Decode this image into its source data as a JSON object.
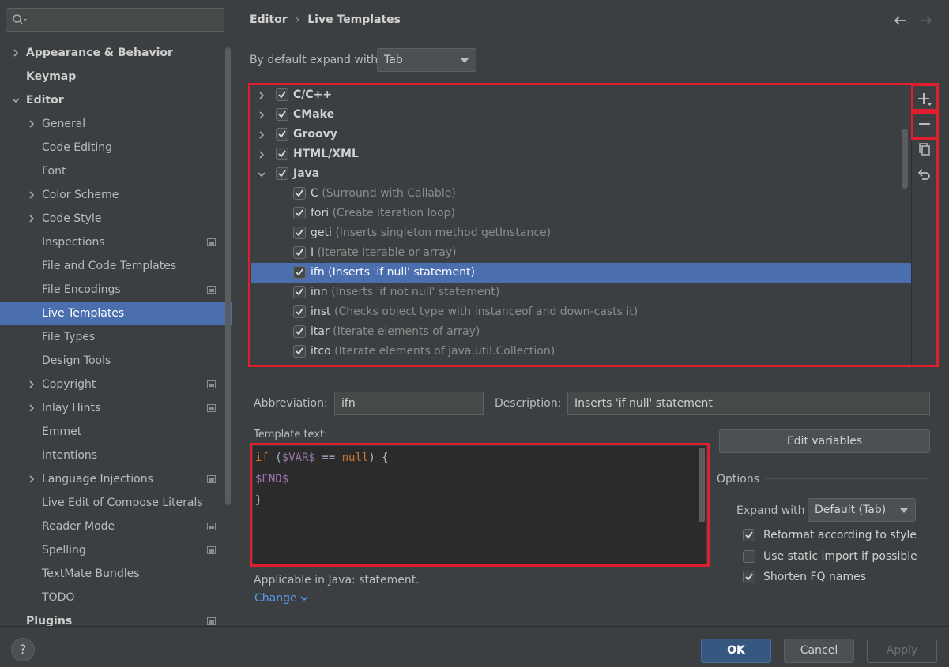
{
  "search": {
    "placeholder": ""
  },
  "sidebar": {
    "items": [
      {
        "label": "Appearance & Behavior",
        "bold": true,
        "chevron": "right",
        "indent": 0
      },
      {
        "label": "Keymap",
        "bold": true,
        "chevron": "",
        "indent": 0
      },
      {
        "label": "Editor",
        "bold": true,
        "chevron": "down",
        "indent": 0
      },
      {
        "label": "General",
        "bold": false,
        "chevron": "right",
        "indent": 1
      },
      {
        "label": "Code Editing",
        "bold": false,
        "chevron": "",
        "indent": 1
      },
      {
        "label": "Font",
        "bold": false,
        "chevron": "",
        "indent": 1
      },
      {
        "label": "Color Scheme",
        "bold": false,
        "chevron": "right",
        "indent": 1
      },
      {
        "label": "Code Style",
        "bold": false,
        "chevron": "right",
        "indent": 1
      },
      {
        "label": "Inspections",
        "bold": false,
        "chevron": "",
        "indent": 1,
        "project_icon": true
      },
      {
        "label": "File and Code Templates",
        "bold": false,
        "chevron": "",
        "indent": 1
      },
      {
        "label": "File Encodings",
        "bold": false,
        "chevron": "",
        "indent": 1,
        "project_icon": true
      },
      {
        "label": "Live Templates",
        "bold": false,
        "chevron": "",
        "indent": 1,
        "selected": true
      },
      {
        "label": "File Types",
        "bold": false,
        "chevron": "",
        "indent": 1
      },
      {
        "label": "Design Tools",
        "bold": false,
        "chevron": "",
        "indent": 1
      },
      {
        "label": "Copyright",
        "bold": false,
        "chevron": "right",
        "indent": 1,
        "project_icon": true
      },
      {
        "label": "Inlay Hints",
        "bold": false,
        "chevron": "right",
        "indent": 1,
        "project_icon": true
      },
      {
        "label": "Emmet",
        "bold": false,
        "chevron": "",
        "indent": 1
      },
      {
        "label": "Intentions",
        "bold": false,
        "chevron": "",
        "indent": 1
      },
      {
        "label": "Language Injections",
        "bold": false,
        "chevron": "right",
        "indent": 1,
        "project_icon": true
      },
      {
        "label": "Live Edit of Compose Literals",
        "bold": false,
        "chevron": "",
        "indent": 1
      },
      {
        "label": "Reader Mode",
        "bold": false,
        "chevron": "",
        "indent": 1,
        "project_icon": true
      },
      {
        "label": "Spelling",
        "bold": false,
        "chevron": "",
        "indent": 1,
        "project_icon": true
      },
      {
        "label": "TextMate Bundles",
        "bold": false,
        "chevron": "",
        "indent": 1
      },
      {
        "label": "TODO",
        "bold": false,
        "chevron": "",
        "indent": 1
      },
      {
        "label": "Plugins",
        "bold": true,
        "chevron": "",
        "indent": 0,
        "project_icon": true
      }
    ]
  },
  "breadcrumb": {
    "parent": "Editor",
    "separator": "›",
    "current": "Live Templates"
  },
  "expand": {
    "label": "By default expand with",
    "value": "Tab"
  },
  "tree": {
    "rows": [
      {
        "name": "C/C++",
        "desc": "",
        "group": true,
        "expanded": false,
        "checked": true
      },
      {
        "name": "CMake",
        "desc": "",
        "group": true,
        "expanded": false,
        "checked": true
      },
      {
        "name": "Groovy",
        "desc": "",
        "group": true,
        "expanded": false,
        "checked": true
      },
      {
        "name": "HTML/XML",
        "desc": "",
        "group": true,
        "expanded": false,
        "checked": true
      },
      {
        "name": "Java",
        "desc": "",
        "group": true,
        "expanded": true,
        "checked": true
      },
      {
        "name": "C",
        "desc": "(Surround with Callable)",
        "group": false,
        "checked": true
      },
      {
        "name": "fori",
        "desc": "(Create iteration loop)",
        "group": false,
        "checked": true
      },
      {
        "name": "geti",
        "desc": "(Inserts singleton method getInstance)",
        "group": false,
        "checked": true
      },
      {
        "name": "I",
        "desc": "(Iterate Iterable or array)",
        "group": false,
        "checked": true
      },
      {
        "name": "ifn",
        "desc": "(Inserts 'if null' statement)",
        "group": false,
        "checked": true,
        "selected": true
      },
      {
        "name": "inn",
        "desc": "(Inserts 'if not null' statement)",
        "group": false,
        "checked": true
      },
      {
        "name": "inst",
        "desc": "(Checks object type with instanceof and down-casts it)",
        "group": false,
        "checked": true
      },
      {
        "name": "itar",
        "desc": "(Iterate elements of array)",
        "group": false,
        "checked": true
      },
      {
        "name": "itco",
        "desc": "(Iterate elements of java.util.Collection)",
        "group": false,
        "checked": true
      }
    ]
  },
  "details": {
    "abbreviation_label": "Abbreviation:",
    "abbreviation_value": "ifn",
    "description_label": "Description:",
    "description_value": "Inserts 'if null' statement",
    "template_text_label": "Template text:",
    "edit_variables": "Edit variables",
    "code": {
      "line1": {
        "kw_if": "if",
        "p1": " (",
        "var": "$VAR$",
        "p2": " == ",
        "kw_null": "null",
        "p3": ") {"
      },
      "line2": "$END$",
      "line3": "}"
    },
    "applicable": "Applicable in Java: statement.",
    "change_link": "Change",
    "options_title": "Options",
    "expand_with_label": "Expand with",
    "expand_with_value": "Default (Tab)",
    "checkboxes": [
      {
        "label": "Reformat according to style",
        "checked": true
      },
      {
        "label": "Use static import if possible",
        "checked": false
      },
      {
        "label": "Shorten FQ names",
        "checked": true
      }
    ]
  },
  "footer": {
    "help": "?",
    "ok": "OK",
    "cancel": "Cancel",
    "apply": "Apply"
  },
  "colors": {
    "accent": "#4b6eaf",
    "highlight_box": "#e01e2d",
    "link": "#589df6"
  }
}
